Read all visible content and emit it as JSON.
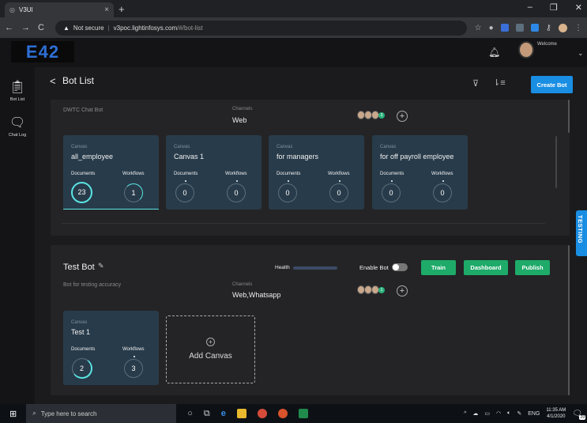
{
  "browser": {
    "tab_title": "V3UI",
    "url_warning": "Not secure",
    "url_host": "v3poc.lightinfosys.com",
    "url_path": "/#/bot-list"
  },
  "header": {
    "logo_text": "E42",
    "welcome": "Welcome"
  },
  "sidebar": {
    "items": [
      {
        "label": "Bot List",
        "icon": "clipboard-icon"
      },
      {
        "label": "Chat Log",
        "icon": "chat-bubbles-icon"
      }
    ]
  },
  "page": {
    "title": "Bot List",
    "create_bot_label": "Create Bot",
    "testing_tab": "TESTING"
  },
  "bots": [
    {
      "name": "DWTC Chat Bot",
      "channels_label": "Channels",
      "channels": "Web",
      "members_extra": "3",
      "canvases": [
        {
          "type_label": "Canvas",
          "name": "all_employee",
          "documents_label": "Documents",
          "workflows_label": "Workflows",
          "documents": "23",
          "workflows": "1"
        },
        {
          "type_label": "Canvas",
          "name": "Canvas 1",
          "documents_label": "Documents",
          "workflows_label": "Workflows",
          "documents": "0",
          "workflows": "0"
        },
        {
          "type_label": "Canvas",
          "name": "for managers",
          "documents_label": "Documents",
          "workflows_label": "Workflows",
          "documents": "0",
          "workflows": "0"
        },
        {
          "type_label": "Canvas",
          "name": "for off payroll employee",
          "documents_label": "Documents",
          "workflows_label": "Workflows",
          "documents": "0",
          "workflows": "0"
        }
      ]
    },
    {
      "name": "Test Bot",
      "description": "Bot for testing accuracy",
      "channels_label": "Channels",
      "channels": "Web,Whatsapp",
      "members_extra": "1",
      "health_label": "Health",
      "enable_label": "Enable Bot",
      "enabled": false,
      "train_label": "Train",
      "dashboard_label": "Dashboard",
      "publish_label": "Publish",
      "add_canvas_label": "Add Canvas",
      "canvases": [
        {
          "type_label": "Canvas",
          "name": "Test 1",
          "documents_label": "Documents",
          "workflows_label": "Workflows",
          "documents": "2",
          "workflows": "3"
        }
      ]
    }
  ],
  "taskbar": {
    "search_placeholder": "Type here to search",
    "lang": "ENG",
    "time": "11:35 AM",
    "date": "4/1/2020",
    "notif_count": "29"
  },
  "colors": {
    "accent": "#1a8ee3",
    "green": "#1eaa69",
    "canvas": "#283b4a"
  }
}
